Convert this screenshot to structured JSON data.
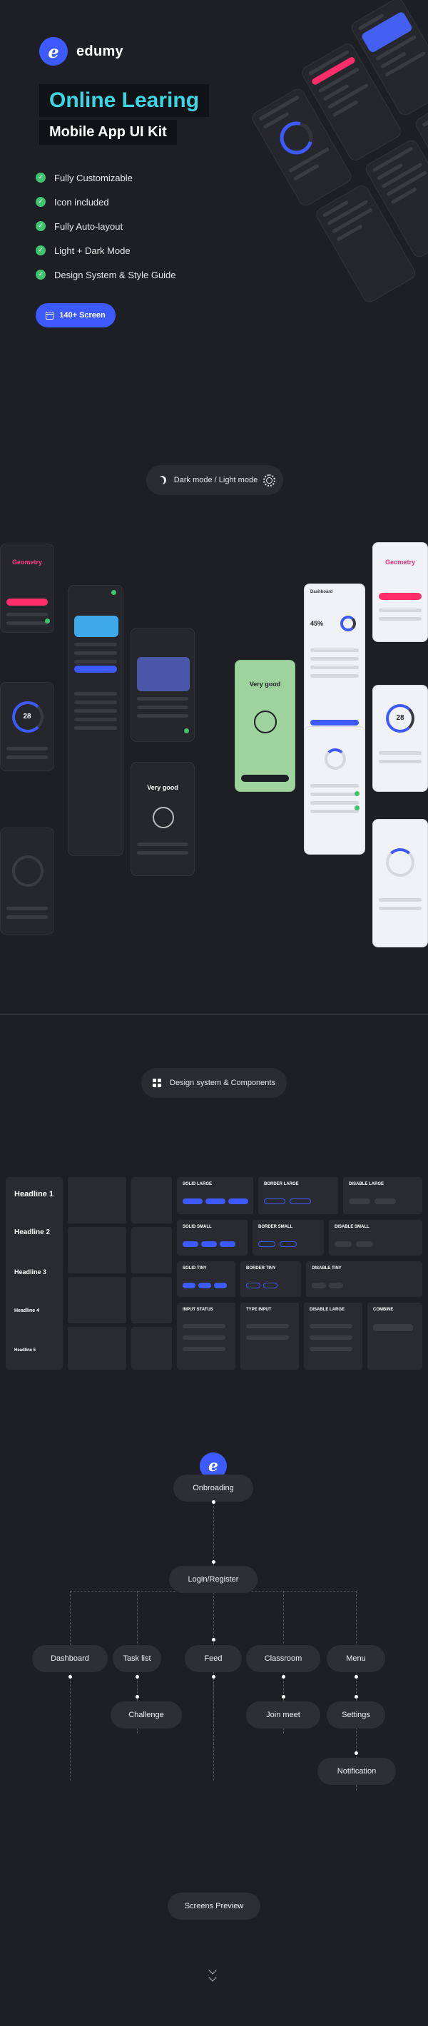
{
  "brand": {
    "logo_letter": "e",
    "name": "edumy"
  },
  "hero": {
    "title": "Online Learing",
    "subtitle": "Mobile App UI Kit",
    "features": [
      "Fully Customizable",
      "Icon included",
      "Fully Auto-layout",
      "Light + Dark Mode",
      "Design System & Style Guide"
    ],
    "cta_label": "140+ Screen"
  },
  "mode_toggle": {
    "label": "Dark mode / Light mode"
  },
  "showcase": {
    "geometry_title": "Geometry",
    "dashboard_title": "Dashboard",
    "feedback_title": "Very good",
    "feedback_dark_title": "Very good",
    "timer_value": "28",
    "timer_value_light": "28",
    "percent": "45%"
  },
  "design_system": {
    "label": "Design system & Components",
    "headlines": [
      "Headline 1",
      "Headline 2",
      "Headline 3",
      "Headline 4",
      "Headline 5"
    ],
    "button_groups": [
      "SOLID LARGE",
      "BORDER LARGE",
      "DISABLE LARGE",
      "SOLID SMALL",
      "BORDER SMALL",
      "DISABLE SMALL",
      "SOLID TINY",
      "BORDER TINY",
      "DISABLE TINY"
    ],
    "input_groups": [
      "INPUT STATUS",
      "TYPE INPUT",
      "DISABLE LARGE",
      "COMBINE"
    ]
  },
  "flow": {
    "logo_letter": "e",
    "onboarding": "Onbroading",
    "login": "Login/Register",
    "level1": [
      "Dashboard",
      "Task list",
      "Feed",
      "Classroom",
      "Menu"
    ],
    "challenge": "Challenge",
    "join_meet": "Join meet",
    "settings": "Settings",
    "notification": "Notification"
  },
  "screens_preview": {
    "label": "Screens Preview"
  },
  "colors": {
    "accent": "#3d5afe",
    "cyan": "#3ad6e4",
    "success": "#3ec46d",
    "pink": "#ff2d6a",
    "bg": "#1e1f24"
  }
}
